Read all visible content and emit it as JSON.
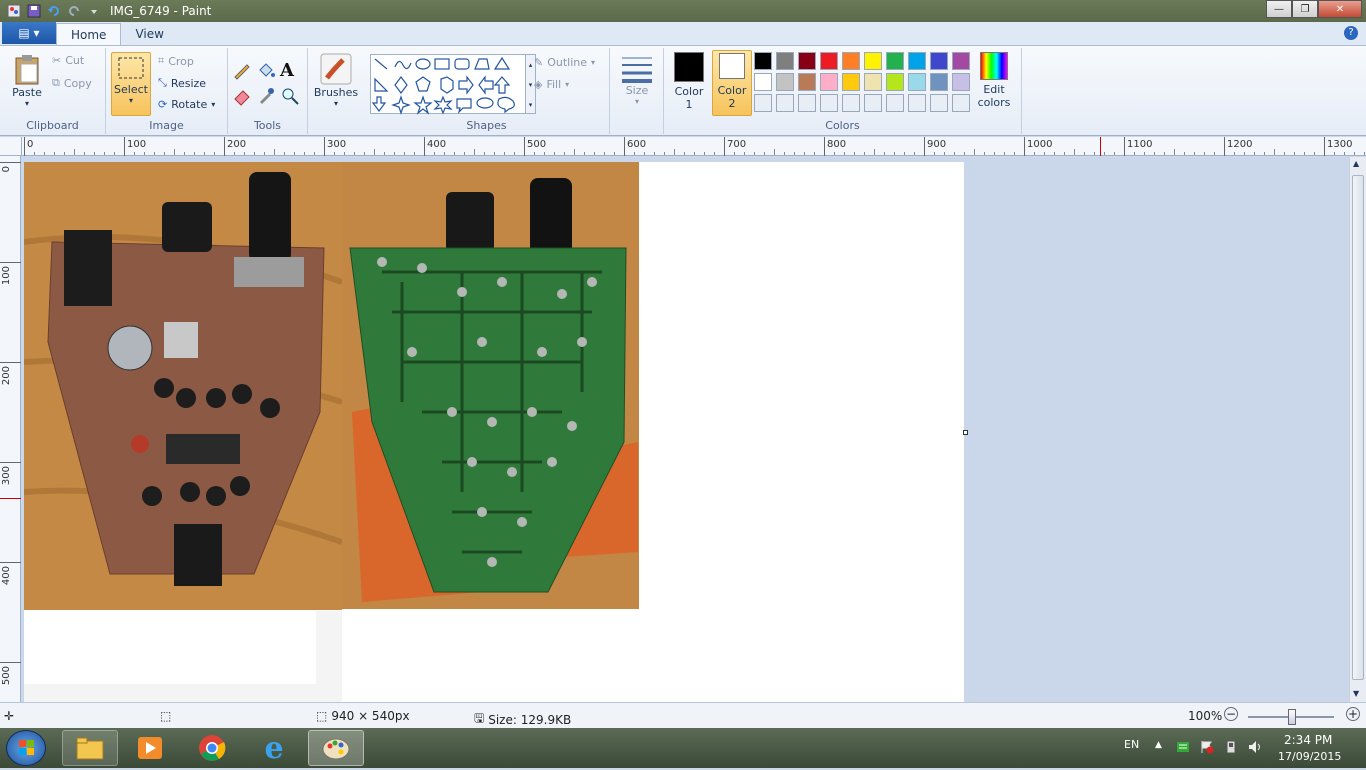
{
  "window": {
    "title": "IMG_6749 - Paint"
  },
  "tabs": {
    "home": "Home",
    "view": "View"
  },
  "clipboard": {
    "group_label": "Clipboard",
    "paste": "Paste",
    "cut": "Cut",
    "copy": "Copy"
  },
  "image": {
    "group_label": "Image",
    "select": "Select",
    "crop": "Crop",
    "resize": "Resize",
    "rotate": "Rotate"
  },
  "tools": {
    "group_label": "Tools"
  },
  "brushes": {
    "label": "Brushes"
  },
  "shapes": {
    "group_label": "Shapes",
    "outline": "Outline",
    "fill": "Fill"
  },
  "size": {
    "label": "Size"
  },
  "colors": {
    "group_label": "Colors",
    "color1_label": "Color",
    "color1_num": "1",
    "color2_label": "Color",
    "color2_num": "2",
    "edit_label": "Edit",
    "edit_label2": "colors",
    "color1": "#000000",
    "color2": "#ffffff",
    "palette_row1": [
      "#000000",
      "#7f7f7f",
      "#880015",
      "#ed1c24",
      "#ff7f27",
      "#fff200",
      "#22b14c",
      "#00a2e8",
      "#3f48cc",
      "#a349a4"
    ],
    "palette_row2": [
      "#ffffff",
      "#c3c3c3",
      "#b97a57",
      "#ffaec9",
      "#ffc90e",
      "#efe4b0",
      "#b5e61d",
      "#99d9ea",
      "#7092be",
      "#c8bfe7"
    ]
  },
  "ruler_h": [
    "0",
    "100",
    "200",
    "300",
    "400",
    "500",
    "600",
    "700",
    "800",
    "900",
    "1000",
    "1100",
    "1200",
    "1300"
  ],
  "ruler_v": [
    "0",
    "100",
    "200",
    "300",
    "400",
    "500"
  ],
  "status": {
    "dimensions": "940 × 540px",
    "size": "Size: 129.9KB",
    "zoom": "100%"
  },
  "tray": {
    "lang": "EN",
    "time": "2:34 PM",
    "date": "17/09/2015"
  }
}
